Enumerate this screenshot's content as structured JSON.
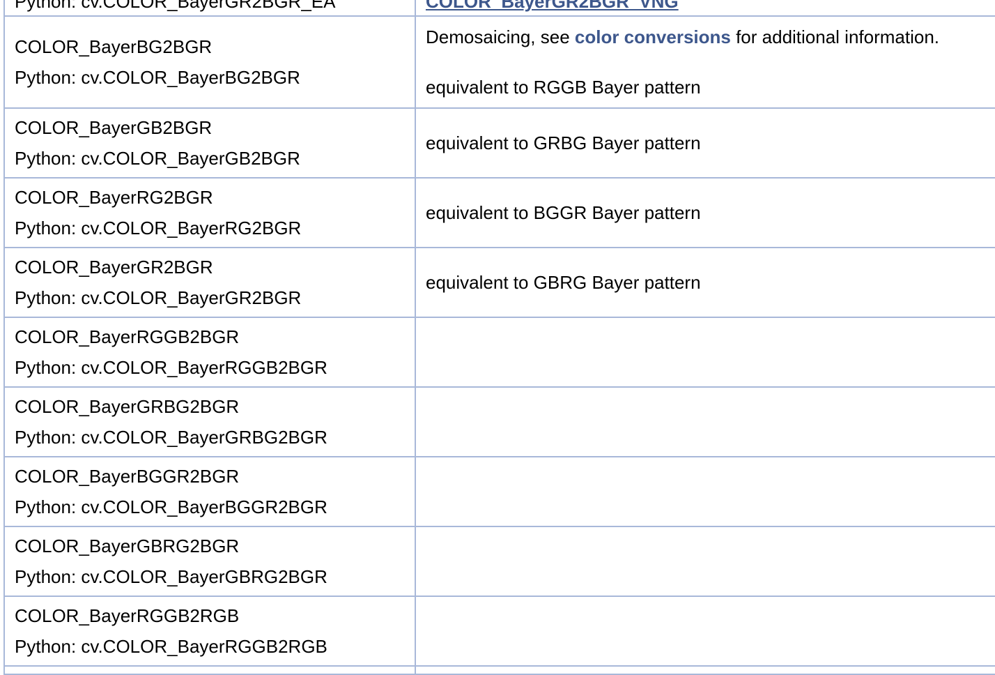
{
  "partial_top_row": {
    "left_text": "Python: cv.COLOR_BayerGR2BGR_EA",
    "right_text": "COLOR_BayerGR2BGR_VNG"
  },
  "rows": [
    {
      "name": "COLOR_BayerBG2BGR",
      "python": "Python: cv.COLOR_BayerBG2BGR",
      "desc_prefix": "Demosaicing, see ",
      "desc_link": "color conversions",
      "desc_suffix": " for additional information.",
      "desc_note": "equivalent to RGGB Bayer pattern"
    },
    {
      "name": "COLOR_BayerGB2BGR",
      "python": "Python: cv.COLOR_BayerGB2BGR",
      "desc": "equivalent to GRBG Bayer pattern"
    },
    {
      "name": "COLOR_BayerRG2BGR",
      "python": "Python: cv.COLOR_BayerRG2BGR",
      "desc": "equivalent to BGGR Bayer pattern"
    },
    {
      "name": "COLOR_BayerGR2BGR",
      "python": "Python: cv.COLOR_BayerGR2BGR",
      "desc": "equivalent to GBRG Bayer pattern"
    },
    {
      "name": "COLOR_BayerRGGB2BGR",
      "python": "Python: cv.COLOR_BayerRGGB2BGR",
      "desc": ""
    },
    {
      "name": "COLOR_BayerGRBG2BGR",
      "python": "Python: cv.COLOR_BayerGRBG2BGR",
      "desc": ""
    },
    {
      "name": "COLOR_BayerBGGR2BGR",
      "python": "Python: cv.COLOR_BayerBGGR2BGR",
      "desc": ""
    },
    {
      "name": "COLOR_BayerGBRG2BGR",
      "python": "Python: cv.COLOR_BayerGBRG2BGR",
      "desc": ""
    },
    {
      "name": "COLOR_BayerRGGB2RGB",
      "python": "Python: cv.COLOR_BayerRGGB2RGB",
      "desc": ""
    }
  ],
  "colors": {
    "border": "#a8b8d9",
    "link": "#3d578c",
    "text": "#000000"
  }
}
